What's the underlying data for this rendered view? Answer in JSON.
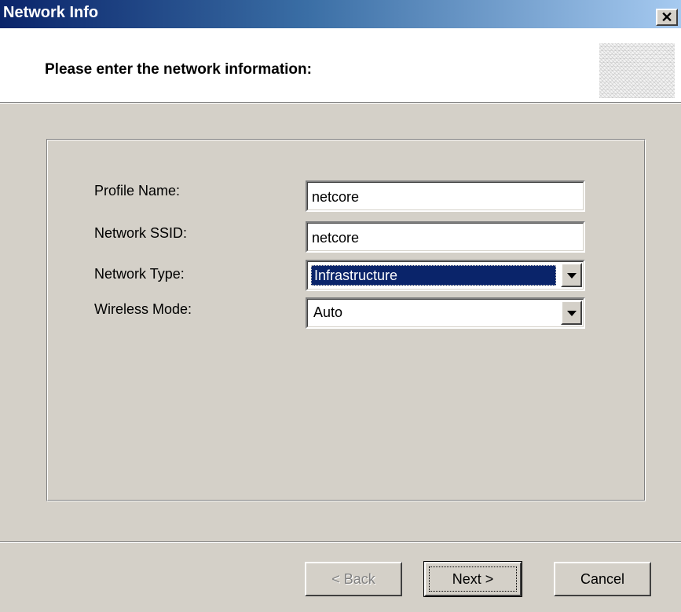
{
  "window": {
    "title": "Network Info",
    "close_icon": "close-icon",
    "close_glyph": "✕"
  },
  "header": {
    "title": "Please enter the network information:"
  },
  "form": {
    "profile_name": {
      "label": "Profile Name:",
      "value": "netcore"
    },
    "network_ssid": {
      "label": "Network SSID:",
      "value": "netcore"
    },
    "network_type": {
      "label": "Network Type:",
      "value": "Infrastructure"
    },
    "wireless_mode": {
      "label": "Wireless Mode:",
      "value": "Auto"
    }
  },
  "buttons": {
    "back": "< Back",
    "next": "Next >",
    "cancel": "Cancel"
  },
  "colors": {
    "title_bar_start": "#0a246a",
    "title_bar_end": "#a6caf0",
    "dialog_face": "#d4d0c8",
    "selection": "#0a246a"
  }
}
